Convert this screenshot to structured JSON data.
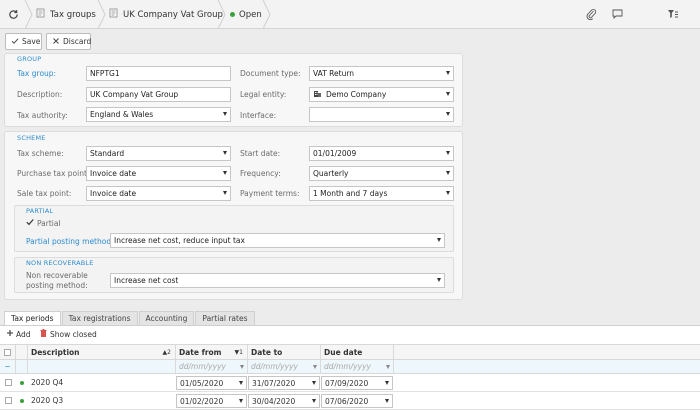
{
  "breadcrumb": {
    "items": [
      {
        "label": "Tax groups"
      },
      {
        "label": "UK Company Vat Group"
      },
      {
        "label": "Open"
      }
    ]
  },
  "toolbar": {
    "save_label": "Save",
    "discard_label": "Discard"
  },
  "group_section": {
    "title": "GROUP",
    "tax_group": {
      "label": "Tax group:",
      "value": "NFPTG1"
    },
    "description": {
      "label": "Description:",
      "value": "UK Company Vat Group"
    },
    "tax_authority": {
      "label": "Tax authority:",
      "value": "England & Wales"
    },
    "document_type": {
      "label": "Document type:",
      "value": "VAT Return"
    },
    "legal_entity": {
      "label": "Legal entity:",
      "value": "Demo Company"
    },
    "interface": {
      "label": "Interface:",
      "value": ""
    }
  },
  "scheme_section": {
    "title": "SCHEME",
    "tax_scheme": {
      "label": "Tax scheme:",
      "value": "Standard"
    },
    "purchase_tax_point": {
      "label": "Purchase tax point:",
      "value": "Invoice date"
    },
    "sale_tax_point": {
      "label": "Sale tax point:",
      "value": "Invoice date"
    },
    "start_date": {
      "label": "Start date:",
      "value": "01/01/2009"
    },
    "frequency": {
      "label": "Frequency:",
      "value": "Quarterly"
    },
    "payment_terms": {
      "label": "Payment terms:",
      "value": "1 Month and 7 days"
    }
  },
  "partial_section": {
    "title": "PARTIAL",
    "checkbox_label": "Partial",
    "method_label": "Partial posting method:",
    "method_value": "Increase net cost, reduce input tax"
  },
  "non_recoverable_section": {
    "title": "NON RECOVERABLE",
    "label_line1": "Non recoverable",
    "label_line2": "posting method:",
    "value": "Increase net cost"
  },
  "tabs": [
    {
      "label": "Tax periods"
    },
    {
      "label": "Tax registrations"
    },
    {
      "label": "Accounting"
    },
    {
      "label": "Partial rates"
    }
  ],
  "grid_toolbar": {
    "add_label": "Add",
    "show_closed_label": "Show closed"
  },
  "grid": {
    "columns": {
      "description": "Description",
      "description_sort": "2",
      "date_from": "Date from",
      "date_from_sort": "1",
      "date_to": "Date to",
      "due_date": "Due date"
    },
    "filter_collapse": "−",
    "date_placeholder": "dd/mm/yyyy",
    "rows": [
      {
        "description": "2020 Q4",
        "date_from": "01/05/2020",
        "date_to": "31/07/2020",
        "due_date": "07/09/2020"
      },
      {
        "description": "2020 Q3",
        "date_from": "01/02/2020",
        "date_to": "30/04/2020",
        "due_date": "07/06/2020"
      }
    ]
  },
  "colors": {
    "accent": "#2d8ccf",
    "status_open": "#3aa13a",
    "delete_red": "#d9534f"
  }
}
